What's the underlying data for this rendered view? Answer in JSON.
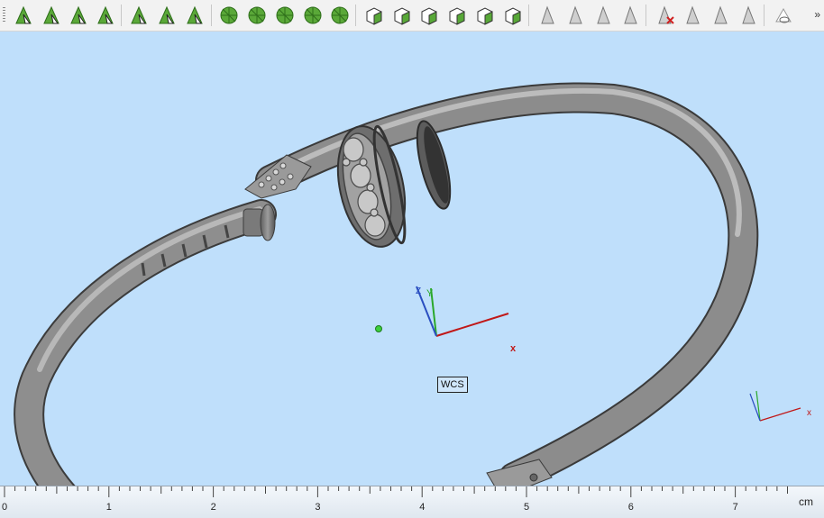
{
  "toolbar": {
    "buttons": [
      {
        "name": "vertex-select-icon"
      },
      {
        "name": "face-select-icon"
      },
      {
        "name": "curve-select-icon"
      },
      {
        "name": "solid-select-icon"
      },
      {
        "name": "plane-select-icon"
      },
      {
        "name": "connected-select-icon"
      },
      {
        "name": "edge-curve-icon"
      },
      {
        "name": "mesh-select-icon"
      },
      {
        "name": "mesh-connected-icon"
      },
      {
        "name": "mesh-pattern-icon"
      },
      {
        "name": "mesh-segments-icon"
      },
      {
        "name": "mesh-fan-icon"
      },
      {
        "name": "box-view-front-icon"
      },
      {
        "name": "box-view-top-icon"
      },
      {
        "name": "box-view-iso-icon"
      },
      {
        "name": "box-view-wire-icon"
      },
      {
        "name": "box-view-section-icon"
      },
      {
        "name": "box-view-render-icon"
      },
      {
        "name": "show-triangle-icon"
      },
      {
        "name": "show-partial-icon"
      },
      {
        "name": "show-flipped-icon"
      },
      {
        "name": "show-add-icon"
      },
      {
        "name": "hide-delete-icon"
      },
      {
        "name": "hide-outline-icon"
      },
      {
        "name": "hide-copy-icon"
      },
      {
        "name": "hide-shade-icon"
      },
      {
        "name": "visibility-eye-icon"
      }
    ],
    "overflow_label": "»"
  },
  "viewport": {
    "wcs_label": "WCS",
    "axis_x_label": "x",
    "axis_y_label": "Y",
    "axis_z_label": "Z"
  },
  "ruler": {
    "ticks": [
      "0",
      "1",
      "2",
      "3",
      "4",
      "5",
      "6",
      "7"
    ],
    "unit": "cm"
  },
  "colors": {
    "viewport_bg": "#bfdffb",
    "model_gray": "#8a8a8a",
    "axis_x": "#c01818",
    "axis_y": "#2aa82a",
    "axis_z": "#2a4ec0"
  }
}
